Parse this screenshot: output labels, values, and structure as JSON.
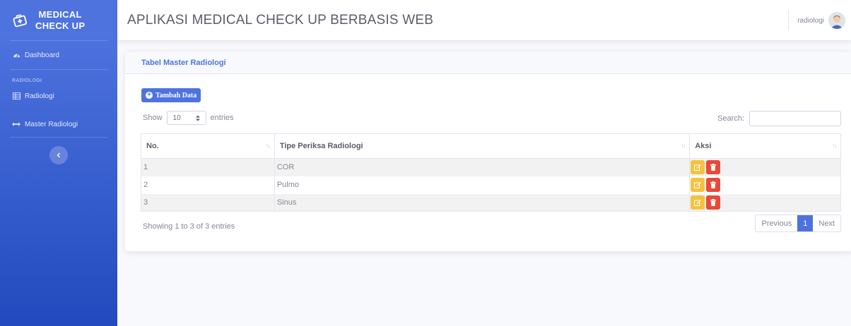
{
  "brand": {
    "line1": "MEDICAL",
    "line2": "CHECK UP"
  },
  "sidebar": {
    "dashboard": "Dashboard",
    "heading": "RADIOLOGI",
    "radiologi": "Radiologi",
    "master": "Master Radiologi"
  },
  "topbar": {
    "title": "APLIKASI MEDICAL CHECK UP BERBASIS WEB",
    "user": "radiologi"
  },
  "card": {
    "title": "Tabel Master Radiologi"
  },
  "toolbar": {
    "add_label": "Tambah Data",
    "show": "Show",
    "entries_value": "10",
    "entries": "entries",
    "search_label": "Search:"
  },
  "table": {
    "headers": [
      "No.",
      "Tipe Periksa Radiologi",
      "Aksi"
    ],
    "rows": [
      {
        "no": "1",
        "tipe": "COR"
      },
      {
        "no": "2",
        "tipe": "Pulmo"
      },
      {
        "no": "3",
        "tipe": "Sinus"
      }
    ]
  },
  "footer": {
    "info": "Showing 1 to 3 of 3 entries",
    "previous": "Previous",
    "page": "1",
    "next": "Next"
  },
  "colors": {
    "primary": "#4e73df",
    "warning": "#f6c23e",
    "danger": "#e74a3b"
  }
}
